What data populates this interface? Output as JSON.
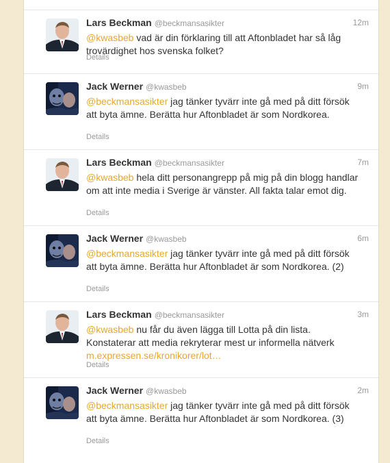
{
  "tweets": [
    {
      "name": "Lars Beckman",
      "handle": "@beckmansasikter",
      "time": "12m",
      "mention": "@kwasbeb",
      "text": " vad är din förklaring till att Aftonbladet har så låg trovärdighet hos svenska folket?",
      "link": "",
      "details": "Details",
      "avatar": "man-in-suit-avatar"
    },
    {
      "name": "Jack Werner",
      "handle": "@kwasbeb",
      "time": "9m",
      "mention": "@beckmansasikter",
      "text": " jag tänker tyvärr inte gå med på ditt försök att byta ämne. Berätta hur Aftonbladet är som Nordkorea.",
      "link": "",
      "details": "Details",
      "avatar": "dark-portrait-avatar"
    },
    {
      "name": "Lars Beckman",
      "handle": "@beckmansasikter",
      "time": "7m",
      "mention": "@kwasbeb",
      "text": " hela ditt personangrepp på mig på din blogg handlar om att inte media i Sverige är vänster. All fakta talar emot dig.",
      "link": "",
      "details": "Details",
      "avatar": "man-in-suit-avatar"
    },
    {
      "name": "Jack Werner",
      "handle": "@kwasbeb",
      "time": "6m",
      "mention": "@beckmansasikter",
      "text": " jag tänker tyvärr inte gå med på ditt försök att byta ämne. Berätta hur Aftonbladet är som Nordkorea. (2)",
      "link": "",
      "details": "Details",
      "avatar": "dark-portrait-avatar"
    },
    {
      "name": "Lars Beckman",
      "handle": "@beckmansasikter",
      "time": "3m",
      "mention": "@kwasbeb",
      "text": " nu får du även lägga till Lotta på din lista. Konstaterar  att media rekryterar mest ur informella nätverk",
      "link": "m.expressen.se/kronikorer/lot…",
      "details": "Details",
      "avatar": "man-in-suit-avatar"
    },
    {
      "name": "Jack Werner",
      "handle": "@kwasbeb",
      "time": "2m",
      "mention": "@beckmansasikter",
      "text": " jag tänker tyvärr inte gå med på ditt försök att byta ämne. Berätta hur Aftonbladet är som Nordkorea. (3)",
      "link": "",
      "details": "Details",
      "avatar": "dark-portrait-avatar"
    }
  ],
  "colors": {
    "background": "#f3ead1",
    "link": "#e8a72b",
    "text": "#333333",
    "meta": "#999999"
  }
}
